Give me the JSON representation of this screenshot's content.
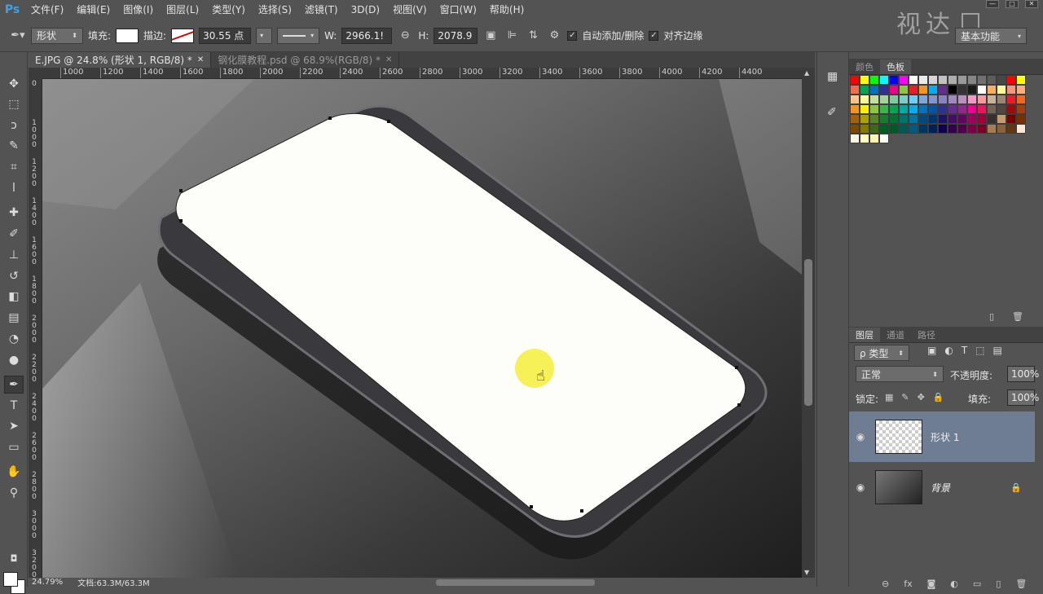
{
  "app": {
    "logo": "Ps"
  },
  "menu": [
    "文件(F)",
    "编辑(E)",
    "图像(I)",
    "图层(L)",
    "类型(Y)",
    "选择(S)",
    "滤镜(T)",
    "3D(D)",
    "视图(V)",
    "窗口(W)",
    "帮助(H)"
  ],
  "watermark": {
    "text": "视达"
  },
  "window_controls": [
    "—",
    "□",
    "✕"
  ],
  "options": {
    "tool_mode": "形状",
    "fill_label": "填充:",
    "fill_color": "#ffffff",
    "stroke_label": "描边:",
    "stroke_size": "30.55 点",
    "w_label": "W:",
    "w_value": "2966.1!",
    "h_label": "H:",
    "h_value": "2078.9",
    "auto_add_label": "自动添加/删除",
    "align_edges_label": "对齐边缘",
    "workspace": "基本功能"
  },
  "tabs": [
    {
      "label": "E.JPG @ 24.8% (形状 1, RGB/8) *",
      "active": true
    },
    {
      "label": "钢化膜教程.psd @ 68.9%(RGB/8) *",
      "active": false
    }
  ],
  "ruler_top": [
    "1000",
    "1200",
    "1400",
    "1600",
    "1800",
    "2000",
    "2200",
    "2400",
    "2600",
    "2800",
    "3000",
    "3200",
    "3400",
    "3600",
    "3800",
    "4000",
    "4200",
    "4400"
  ],
  "ruler_left": [
    "0",
    "1000",
    "1200",
    "1400",
    "1600",
    "1800",
    "2000",
    "2200",
    "2400",
    "2600",
    "2800",
    "3000",
    "3200"
  ],
  "status": {
    "zoom": "24.79%",
    "doc": "文档:63.3M/63.3M"
  },
  "colors_panel": {
    "tabs": [
      "颜色",
      "色板"
    ],
    "active": "色板"
  },
  "swatch_colors": [
    "#ff0000",
    "#ffff00",
    "#00ff00",
    "#00ffff",
    "#0000ff",
    "#ff00ff",
    "#ffffff",
    "#ebebeb",
    "#d6d6d6",
    "#c2c2c2",
    "#adadad",
    "#999999",
    "#858585",
    "#707070",
    "#5c5c5c",
    "#474747",
    "#ff0000",
    "#ffff00",
    "#f26c4f",
    "#00a651",
    "#0072bc",
    "#2e3192",
    "#ec008c",
    "#8dc63f",
    "#ed1c24",
    "#f7941d",
    "#00aeef",
    "#662d91",
    "#000000",
    "#333333",
    "#1a1a1a",
    "#ffffff",
    "#fbaf5d",
    "#fff799",
    "#f7977a",
    "#f9ad81",
    "#fdc68a",
    "#fff79a",
    "#c4df9b",
    "#a3d39c",
    "#82ca9d",
    "#7bcdc8",
    "#6ecff6",
    "#7ea7d8",
    "#8493ca",
    "#8882be",
    "#a187be",
    "#bc8dbf",
    "#f49ac2",
    "#f6989d",
    "#c7b299",
    "#998675",
    "#ed1c24",
    "#f26522",
    "#f7941d",
    "#fff200",
    "#8dc73f",
    "#39b54a",
    "#00a651",
    "#00a99d",
    "#00aeef",
    "#0072bc",
    "#0054a6",
    "#2e3192",
    "#662d91",
    "#92278f",
    "#ec008c",
    "#ed145b",
    "#736357",
    "#534741",
    "#9e0b0f",
    "#a0410d",
    "#a3620a",
    "#aba000",
    "#598527",
    "#197b30",
    "#007236",
    "#00746b",
    "#0076a3",
    "#004a80",
    "#003471",
    "#1b1464",
    "#440e62",
    "#630460",
    "#9e005d",
    "#9e0039",
    "#362f2d",
    "#c69c6d",
    "#790000",
    "#7b2e00",
    "#7d4900",
    "#827b00",
    "#406618",
    "#005e20",
    "#005826",
    "#005952",
    "#005b7f",
    "#003663",
    "#002157",
    "#0d004c",
    "#32004b",
    "#4b0049",
    "#7b0046",
    "#7a0026",
    "#a67c52",
    "#8c6239",
    "#603913",
    "#fce9d5",
    "#fef6e4",
    "#fefbc4",
    "#fff5b2",
    "#ffffff"
  ],
  "layers_panel": {
    "tabs": [
      "图层",
      "通道",
      "路径"
    ],
    "kind_filter": "ρ 类型",
    "blend_mode": "正常",
    "opacity_label": "不透明度:",
    "opacity_value": "100%",
    "lock_label": "锁定:",
    "fill_label": "填充:",
    "fill_value": "100%",
    "layers": [
      {
        "name": "形状 1",
        "selected": true
      },
      {
        "name": "背景",
        "selected": false
      }
    ]
  }
}
